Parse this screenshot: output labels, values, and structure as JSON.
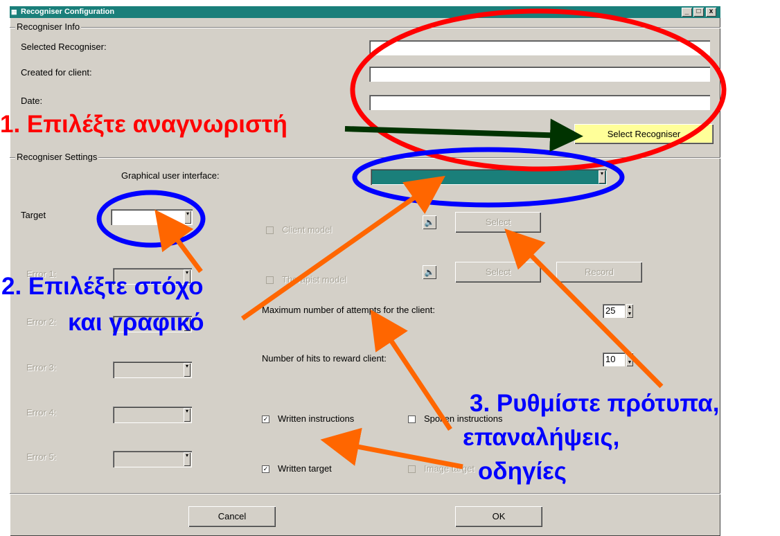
{
  "window": {
    "title": "Recogniser Configuration",
    "controls": [
      "_",
      "□",
      "x"
    ]
  },
  "info_group": {
    "title": "Recogniser Info",
    "selected_label": "Selected Recogniser:",
    "client_label": "Created for client:",
    "date_label": "Date:",
    "selected_value": "",
    "client_value": "",
    "date_value": "",
    "select_button": "Select Recogniser"
  },
  "settings_group": {
    "title": "Recogniser Settings",
    "gui_label": "Graphical user interface:",
    "gui_value": "",
    "target_label": "Target",
    "target_value": "",
    "errors": [
      "Error 1:",
      "Error 2:",
      "Error 3:",
      "Error 4:",
      "Error 5:"
    ],
    "client_model_label": "Client model",
    "therapist_model_label": "Therapist model",
    "select_button": "Select",
    "record_button": "Record",
    "max_attempts_label": "Maximum number of attempts for the client:",
    "max_attempts_value": "25",
    "hits_label": "Number of hits to reward client:",
    "hits_value": "10",
    "written_instructions": "Written instructions",
    "spoken_instructions": "Spoken instructions",
    "written_target": "Written target",
    "image_target": "Image target"
  },
  "footer": {
    "cancel": "Cancel",
    "ok": "OK"
  },
  "annotations": {
    "step1": "1. Επιλέξτε αναγνωριστή",
    "step2_line1": "2. Επιλέξτε στόχο",
    "step2_line2": "και γραφικό",
    "step3_line1": "3. Ρυθμίστε πρότυπα,",
    "step3_line2": "επαναλήψεις,",
    "step3_line3": "οδηγίες"
  },
  "colors": {
    "title_bar": "#1a7f7a",
    "window_bg": "#d4d0c8",
    "gui_combo": "#1a7f7a",
    "button_yellow": "#ffff99",
    "annot_red": "#ff0000",
    "annot_blue": "#0000ff",
    "arrow_orange": "#ff6600",
    "arrow_green": "#003300"
  }
}
